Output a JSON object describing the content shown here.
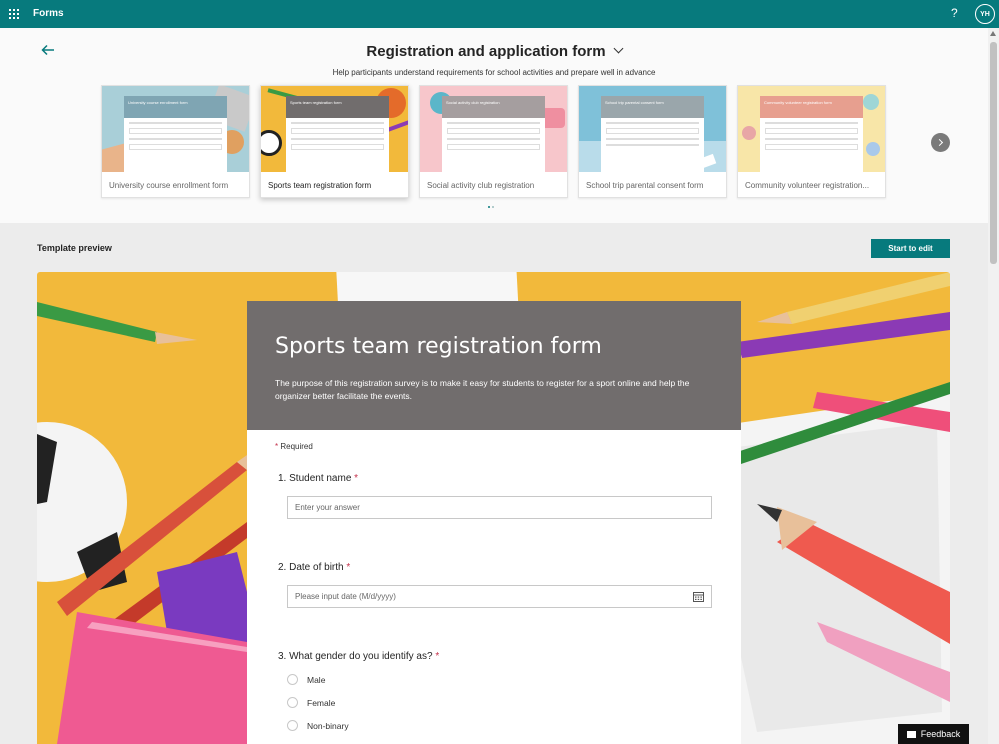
{
  "app": {
    "name": "Forms",
    "help": "?",
    "avatar": "YH"
  },
  "panel": {
    "title": "Registration and application form",
    "subtitle": "Help participants understand requirements for school activities and prepare well in advance"
  },
  "templates": [
    {
      "label": "University course enrollment form",
      "mini_title": "University course enrollment form",
      "selected": false
    },
    {
      "label": "Sports team registration form",
      "mini_title": "Sports team registration form",
      "selected": true
    },
    {
      "label": "Social activity club registration",
      "mini_title": "Social activity club registration",
      "selected": false
    },
    {
      "label": "School trip parental consent form",
      "mini_title": "School trip parental consent form",
      "selected": false
    },
    {
      "label": "Community volunteer registration...",
      "mini_title": "Community volunteer registration form",
      "selected": false
    }
  ],
  "preview": {
    "label": "Template preview",
    "edit_button": "Start to edit"
  },
  "form": {
    "title": "Sports team registration form",
    "description": "The purpose of this registration survey is to make it easy for students to register for a sport online and help the organizer better facilitate the events.",
    "required_note": "Required",
    "questions": [
      {
        "label": "1. Student name",
        "placeholder": "Enter your answer"
      },
      {
        "label": "2. Date of birth",
        "placeholder": "Please input date (M/d/yyyy)"
      },
      {
        "label": "3. What gender do you identify as?",
        "options": [
          "Male",
          "Female",
          "Non-binary"
        ]
      }
    ]
  },
  "feedback": "Feedback",
  "colors": {
    "topbar": "#077a7d",
    "form_header": "#716d6d",
    "required": "#c4314b",
    "preview_bg": "#f2b93b"
  }
}
